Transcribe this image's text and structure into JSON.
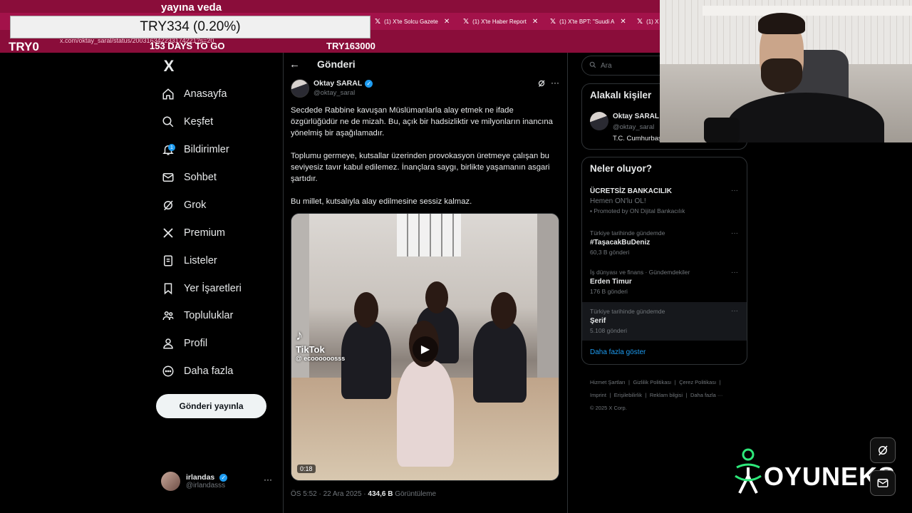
{
  "browser": {
    "tabs": [
      {
        "label": "(1) X'te Solcu Gazete"
      },
      {
        "label": "(1) X'te Haber Report"
      },
      {
        "label": "(1) X'te BPT: \"Suudi A"
      },
      {
        "label": "(1) X"
      }
    ],
    "url": "x.com/oktay_saral/status/200316342233174221?s=20"
  },
  "overlay": {
    "veda": "yayına veda",
    "try_box": "TRY334 (0.20%)",
    "try0": "TRY0",
    "days": "153 DAYS TO GO",
    "try163": "TRY163000"
  },
  "nav": {
    "brand": "X",
    "items": [
      {
        "label": "Anasayfa",
        "icon": "home-icon"
      },
      {
        "label": "Keşfet",
        "icon": "search-icon"
      },
      {
        "label": "Bildirimler",
        "icon": "bell-icon",
        "badge": "1"
      },
      {
        "label": "Sohbet",
        "icon": "mail-icon"
      },
      {
        "label": "Grok",
        "icon": "grok-icon"
      },
      {
        "label": "Premium",
        "icon": "x-icon"
      },
      {
        "label": "Listeler",
        "icon": "list-icon"
      },
      {
        "label": "Yer İşaretleri",
        "icon": "bookmark-icon"
      },
      {
        "label": "Topluluklar",
        "icon": "communities-icon"
      },
      {
        "label": "Profil",
        "icon": "profile-icon"
      },
      {
        "label": "Daha fazla",
        "icon": "more-icon"
      }
    ],
    "post_button": "Gönderi yayınla",
    "account": {
      "name": "irlandas",
      "handle": "@irlandasss",
      "more": "···"
    }
  },
  "post": {
    "header": "Gönderi",
    "author_name": "Oktay SARAL",
    "author_handle": "@oktay_saral",
    "paragraphs": [
      "Secdede Rabbine kavuşan Müslümanlarla alay etmek ne ifade özgürlüğüdür ne de mizah. Bu, açık bir hadsizliktir ve milyonların inancına yönelmiş bir aşağılamadır.",
      "Toplumu germeye, kutsallar üzerinden provokasyon üretmeye çalışan bu seviyesiz tavır kabul edilemez. İnançlara saygı, birlikte yaşamanın asgari şartıdır.",
      "Bu millet, kutsalıyla alay edilmesine sessiz kalmaz."
    ],
    "video": {
      "tiktok_logo": "♪",
      "tiktok_label": "TikTok",
      "tiktok_user": "@ ecoooooosss",
      "duration": "0:18"
    },
    "time": "ÖS 5:52 · 22 Ara 2025 · ",
    "views_count": "434,6 B",
    "views_label": " Görüntüleme",
    "more": "···"
  },
  "sidebar": {
    "search_placeholder": "Ara",
    "related": {
      "title": "Alakalı kişiler",
      "name": "Oktay SARAL",
      "handle": "@oktay_saral",
      "bio": "T.C. Cumhurbaş"
    },
    "trends_title": "Neler oluyor?",
    "trends": [
      {
        "name": "ÜCRETSİZ BANKACILIK",
        "sub": "Hemen ON'lu OL!",
        "promo": "Promoted by ON Dijital Bankacılık"
      },
      {
        "category": "Türkiye tarihinde gündemde",
        "name": "#TaşacakBuDeniz",
        "count": "60,3 B gönderi"
      },
      {
        "category": "İş dünyası ve finans · Gündemdekiler",
        "name": "Erden Timur",
        "count": "176 B gönderi"
      },
      {
        "category": "Türkiye tarihinde gündemde",
        "name": "Şerif",
        "count": "5.108 gönderi"
      }
    ],
    "show_more": "Daha fazla göster",
    "footer": [
      "Hizmet Şartları",
      "|",
      "Gizlilik Politikası",
      "|",
      "Çerez Politikası",
      "|",
      "Imprint",
      "|",
      "Erişilebilirlik",
      "|",
      "Reklam bilgisi",
      "|",
      "Daha fazla ···",
      "© 2025 X Corp."
    ]
  },
  "brand": {
    "name": "OYUNEKS"
  },
  "colors": {
    "accent": "#1d9bf0",
    "chrome": "#8a0d3a",
    "bg": "#000000"
  }
}
